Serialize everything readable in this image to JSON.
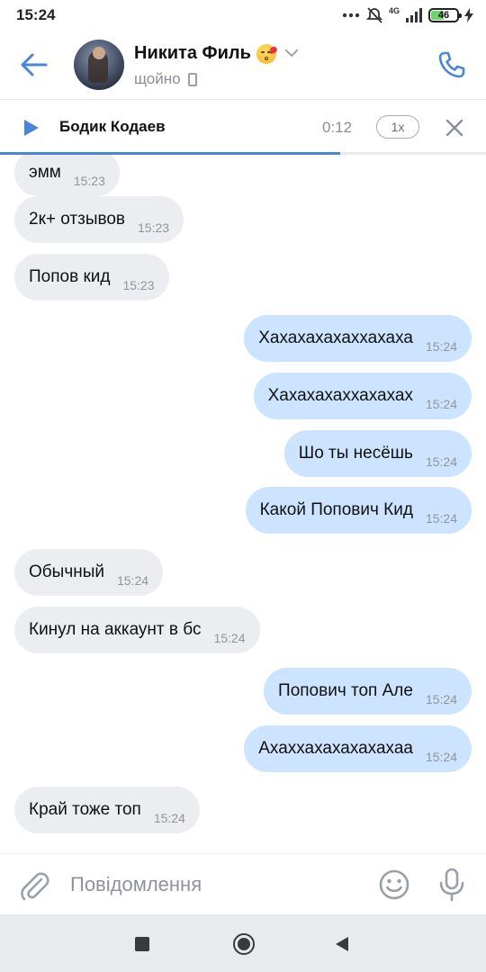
{
  "status_bar": {
    "time": "15:24",
    "network": "4G",
    "battery": "46"
  },
  "header": {
    "contact_name": "Никита Филь",
    "contact_status": "щойно"
  },
  "player": {
    "title": "Бодик Кодаев",
    "time": "0:12",
    "speed": "1x",
    "progress": 0.7
  },
  "messages": [
    {
      "dir": "in",
      "text": "эмм",
      "time": "15:23"
    },
    {
      "dir": "in",
      "text": "2к+ отзывов",
      "time": "15:23"
    },
    {
      "dir": "in",
      "text": "Попов кид",
      "time": "15:23"
    },
    {
      "dir": "out",
      "text": "Хахахахахаххахаха",
      "time": "15:24"
    },
    {
      "dir": "out",
      "text": "Хахахахаххахахах",
      "time": "15:24"
    },
    {
      "dir": "out",
      "text": "Шо ты несёшь",
      "time": "15:24"
    },
    {
      "dir": "out",
      "text": "Какой Попович Кид",
      "time": "15:24"
    },
    {
      "dir": "in",
      "text": "Обычный",
      "time": "15:24"
    },
    {
      "dir": "in",
      "text": "Кинул на аккаунт в бс",
      "time": "15:24"
    },
    {
      "dir": "out",
      "text": "Попович топ Але",
      "time": "15:24"
    },
    {
      "dir": "out",
      "text": "Ахаххахахахахахаа",
      "time": "15:24"
    },
    {
      "dir": "in",
      "text": "Край тоже топ",
      "time": "15:24"
    }
  ],
  "composer": {
    "placeholder": "Повідомлення"
  },
  "colors": {
    "accent": "#4a86d8",
    "incoming_bubble": "#ebedf0",
    "outgoing_bubble": "#cce4ff"
  }
}
